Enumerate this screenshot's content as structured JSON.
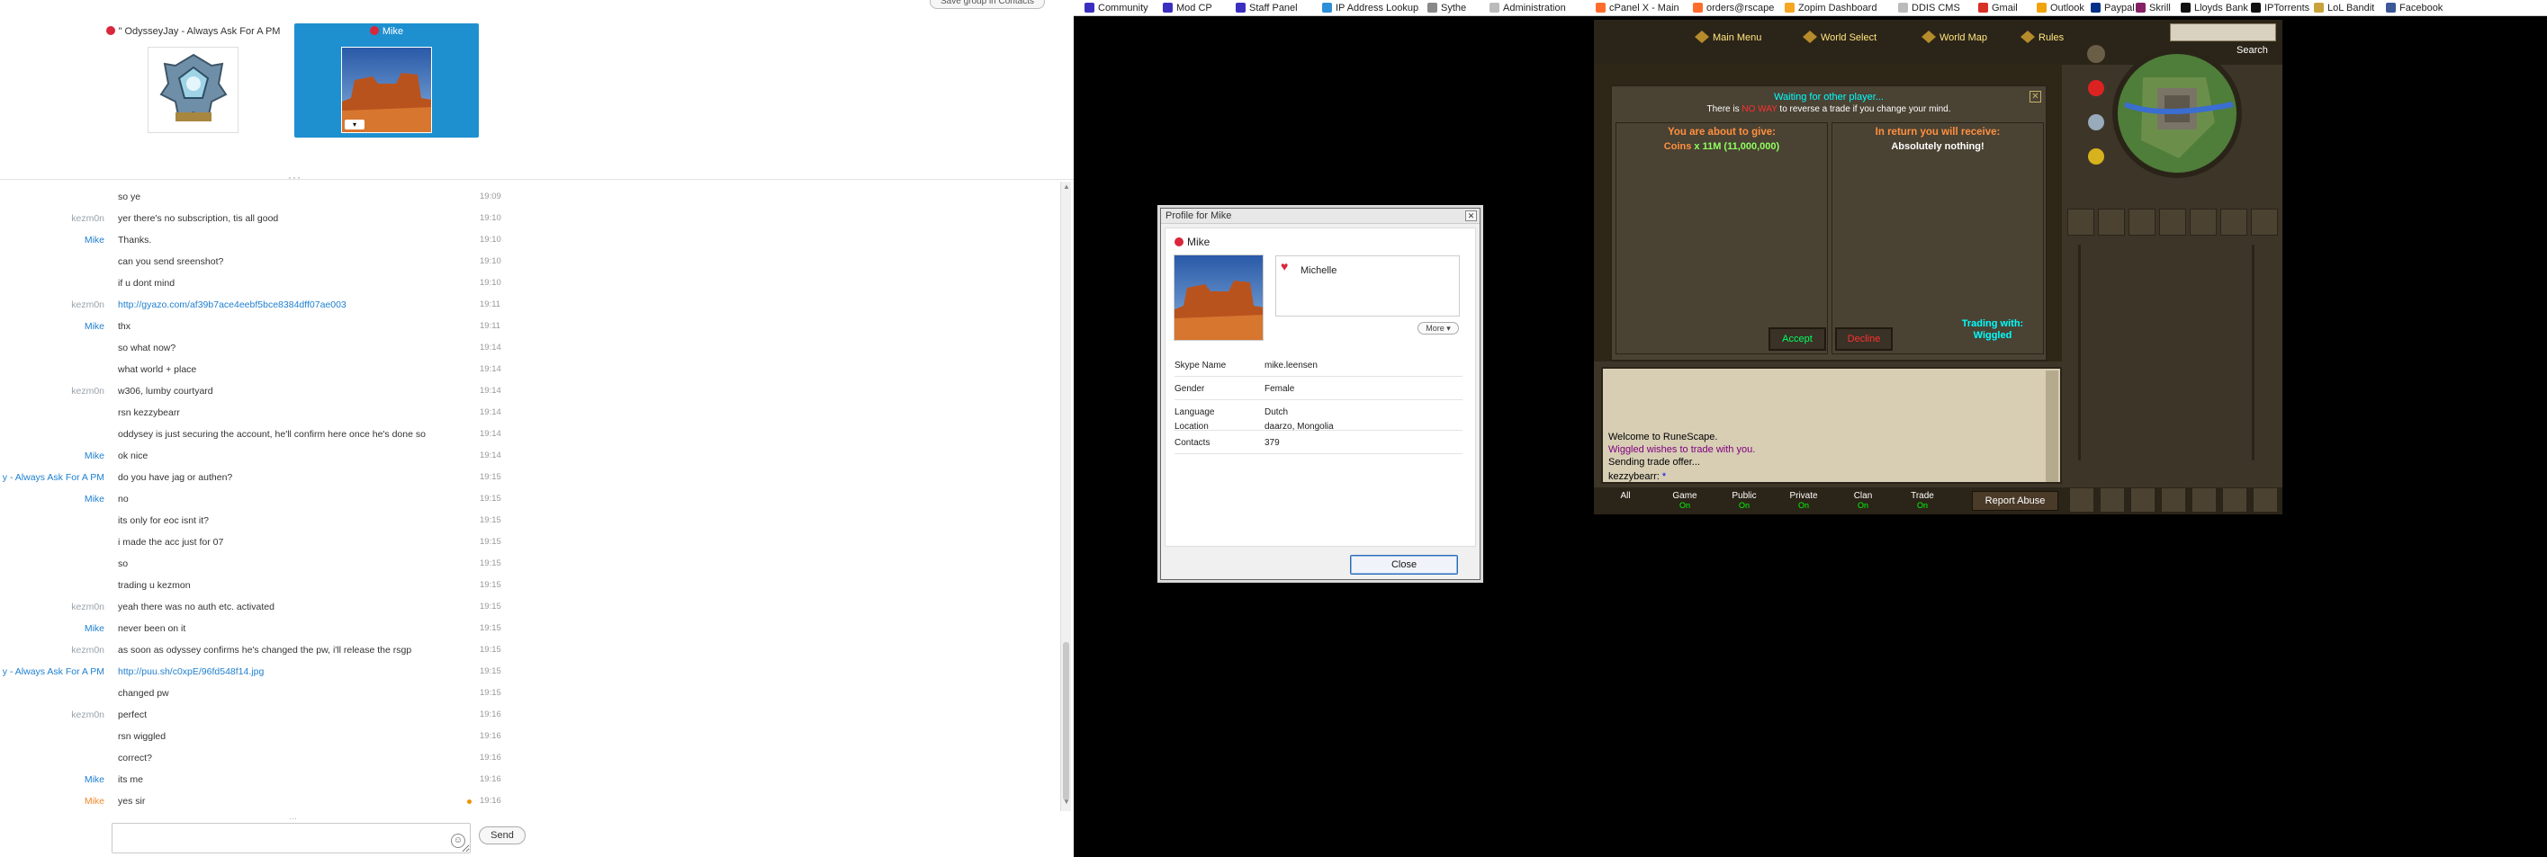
{
  "chat": {
    "top_button": "Save group in Contacts",
    "participants": [
      {
        "name": "\" OdysseyJay - Always Ask For A PM"
      },
      {
        "name": "Mike"
      }
    ],
    "messages": [
      {
        "sender": "",
        "text": "so ye",
        "time": "19:09"
      },
      {
        "sender": "kezm0n",
        "text": "yer there's no subscription, tis all good",
        "time": "19:10"
      },
      {
        "sender": "Mike",
        "text": "Thanks.",
        "time": "19:10",
        "color": "blue"
      },
      {
        "sender": "",
        "text": "can you send sreenshot?",
        "time": "19:10"
      },
      {
        "sender": "",
        "text": "if u dont mind",
        "time": "19:10"
      },
      {
        "sender": "kezm0n",
        "text": "http://gyazo.com/af39b7ace4eebf5bce8384dff07ae003",
        "time": "19:11",
        "link": true
      },
      {
        "sender": "Mike",
        "text": "thx",
        "time": "19:11",
        "color": "blue"
      },
      {
        "sender": "",
        "text": "so what now?",
        "time": "19:14"
      },
      {
        "sender": "",
        "text": "what world + place",
        "time": "19:14"
      },
      {
        "sender": "kezm0n",
        "text": "w306, lumby courtyard",
        "time": "19:14"
      },
      {
        "sender": "",
        "text": "rsn kezzybearr",
        "time": "19:14"
      },
      {
        "sender": "",
        "text": "oddysey is just securing the account, he'll confirm here once he's done so",
        "time": "19:14"
      },
      {
        "sender": "Mike",
        "text": "ok nice",
        "time": "19:14",
        "color": "blue"
      },
      {
        "sender": "y - Always Ask For A PM",
        "text": "do you have jag or authen?",
        "time": "19:15",
        "color": "blue"
      },
      {
        "sender": "Mike",
        "text": "no",
        "time": "19:15",
        "color": "blue"
      },
      {
        "sender": "",
        "text": "its only for eoc isnt it?",
        "time": "19:15"
      },
      {
        "sender": "",
        "text": "i made the acc just for 07",
        "time": "19:15"
      },
      {
        "sender": "",
        "text": "so",
        "time": "19:15"
      },
      {
        "sender": "",
        "text": "trading u kezmon",
        "time": "19:15"
      },
      {
        "sender": "kezm0n",
        "text": "yeah there was no auth etc. activated",
        "time": "19:15"
      },
      {
        "sender": "Mike",
        "text": "never been on it",
        "time": "19:15",
        "color": "blue"
      },
      {
        "sender": "kezm0n",
        "text": "as soon as odyssey confirms he's changed the pw, i'll release the rsgp",
        "time": "19:15"
      },
      {
        "sender": "y - Always Ask For A PM",
        "text": "http://puu.sh/c0xpE/96fd548f14.jpg",
        "time": "19:15",
        "color": "blue",
        "link": true
      },
      {
        "sender": "",
        "text": "changed pw",
        "time": "19:15"
      },
      {
        "sender": "kezm0n",
        "text": "perfect",
        "time": "19:16"
      },
      {
        "sender": "",
        "text": "rsn wiggled",
        "time": "19:16"
      },
      {
        "sender": "",
        "text": "correct?",
        "time": "19:16"
      },
      {
        "sender": "Mike",
        "text": "its me",
        "time": "19:16",
        "color": "blue"
      },
      {
        "sender": "Mike",
        "text": "yes sir",
        "time": "19:16",
        "color": "orange",
        "unread": true
      }
    ],
    "input_placeholder": "",
    "send_label": "Send",
    "emoji_icon": "☺"
  },
  "bookmarks": [
    {
      "label": "Community",
      "icon": "runescape-icon",
      "color": "#3b2fbf"
    },
    {
      "label": "Mod CP",
      "icon": "runescape-icon",
      "color": "#3b2fbf"
    },
    {
      "label": "Staff Panel",
      "icon": "runescape-icon",
      "color": "#3b2fbf"
    },
    {
      "label": "IP Address Lookup",
      "icon": "globe-icon",
      "color": "#2d8fd6"
    },
    {
      "label": "Sythe",
      "icon": "sythe-icon",
      "color": "#888888"
    },
    {
      "label": "Administration",
      "icon": "page-icon",
      "color": "#bbbbbb"
    },
    {
      "label": "cPanel X - Main",
      "icon": "cpanel-icon",
      "color": "#ff6c2c"
    },
    {
      "label": "orders@rscape",
      "icon": "cpanel-icon",
      "color": "#ff6c2c"
    },
    {
      "label": "Zopim Dashboard",
      "icon": "zopim-icon",
      "color": "#f5a623"
    },
    {
      "label": "DDIS CMS",
      "icon": "page-icon",
      "color": "#bbbbbb"
    },
    {
      "label": "Gmail",
      "icon": "gmail-icon",
      "color": "#d93025"
    },
    {
      "label": "Outlook",
      "icon": "outlook-icon",
      "color": "#f0a30a"
    },
    {
      "label": "Paypal",
      "icon": "paypal-icon",
      "color": "#003087"
    },
    {
      "label": "Skrill",
      "icon": "skrill-icon",
      "color": "#862165"
    },
    {
      "label": "Lloyds Bank",
      "icon": "lloyds-icon",
      "color": "#111111"
    },
    {
      "label": "IPTorrents",
      "icon": "iptorrents-icon",
      "color": "#111111"
    },
    {
      "label": "LoL Bandit",
      "icon": "lol-icon",
      "color": "#c8a23a"
    },
    {
      "label": "Facebook",
      "icon": "facebook-icon",
      "color": "#3b5998"
    }
  ],
  "profile": {
    "window_title": "Profile for Mike",
    "name": "Mike",
    "mood": "Michelle",
    "more_label": "More ▾",
    "fields": [
      {
        "key": "Skype Name",
        "value": "mike.leensen"
      },
      {
        "key": "Gender",
        "value": "Female"
      },
      {
        "key": "Language",
        "value": "Dutch"
      },
      {
        "key": "Location",
        "value": "daarzo, Mongolia"
      },
      {
        "key": "Contacts",
        "value": "379"
      }
    ],
    "close_label": "Close"
  },
  "game": {
    "menu": [
      {
        "label": "Main Menu"
      },
      {
        "label": "World Select"
      },
      {
        "label": "World Map"
      },
      {
        "label": "Rules"
      }
    ],
    "search_label": "Search",
    "trade": {
      "waiting": "Waiting for other player...",
      "warning_pre": "There is",
      "warning_red": "NO WAY",
      "warning_post": "to reverse a trade if you change your mind.",
      "give_title": "You are about to give:",
      "give_item": "Coins",
      "give_qty": "x 11M (11,000,000)",
      "recv_title": "In return you will receive:",
      "recv_item": "Absolutely nothing!",
      "accept_label": "Accept",
      "decline_label": "Decline",
      "trading_with_label": "Trading with:",
      "trading_with_name": "Wiggled"
    },
    "chatbox": [
      "Welcome to RuneScape.",
      "Wiggled wishes to trade with you.",
      "Sending trade offer..."
    ],
    "chat_input": "kezzybearr:",
    "chat_cursor": "*",
    "tabs": [
      {
        "label": "All",
        "status": ""
      },
      {
        "label": "Game",
        "status": "On"
      },
      {
        "label": "Public",
        "status": "On"
      },
      {
        "label": "Private",
        "status": "On"
      },
      {
        "label": "Clan",
        "status": "On"
      },
      {
        "label": "Trade",
        "status": "On"
      }
    ],
    "report_label": "Report Abuse"
  }
}
